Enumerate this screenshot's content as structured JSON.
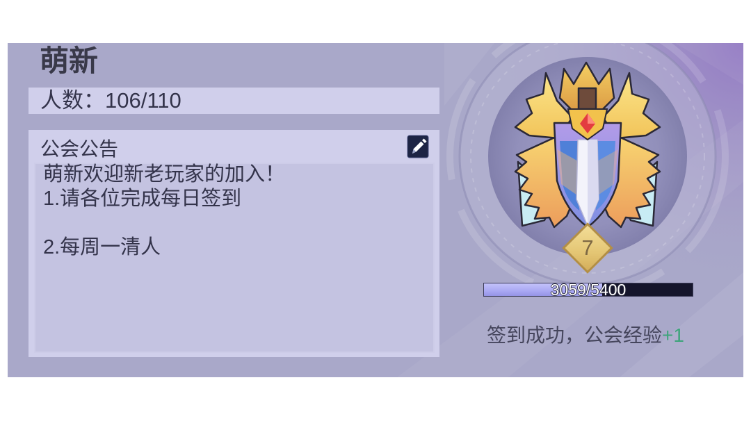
{
  "colors": {
    "panel_bg": "#a9a8c9",
    "card_bg": "#d0cfeb",
    "content_bg": "#c4c3e1",
    "title_text": "#393949",
    "body_text": "#33334a",
    "message_text": "#45455c",
    "reward_green": "#3ea47b",
    "exp_fill": "#a9a8f3",
    "exp_track": "#15152b",
    "badge_gold": "#e4c674"
  },
  "icons": {
    "edit": "pencil-icon",
    "emblem": "guild-emblem-icon"
  },
  "guild": {
    "name": "萌新",
    "members_label": "人数：",
    "members_count": "106/110"
  },
  "announcement": {
    "title": "公会公告",
    "lines": [
      "萌新欢迎新老玩家的加入！",
      "1.请各位完成每日签到",
      "",
      "2.每周一清人"
    ]
  },
  "emblem": {
    "level": 7
  },
  "experience": {
    "current": 3059,
    "max": 5400,
    "label": "3059/5400"
  },
  "checkin": {
    "message": "签到成功，公会经验",
    "reward": "+1"
  }
}
